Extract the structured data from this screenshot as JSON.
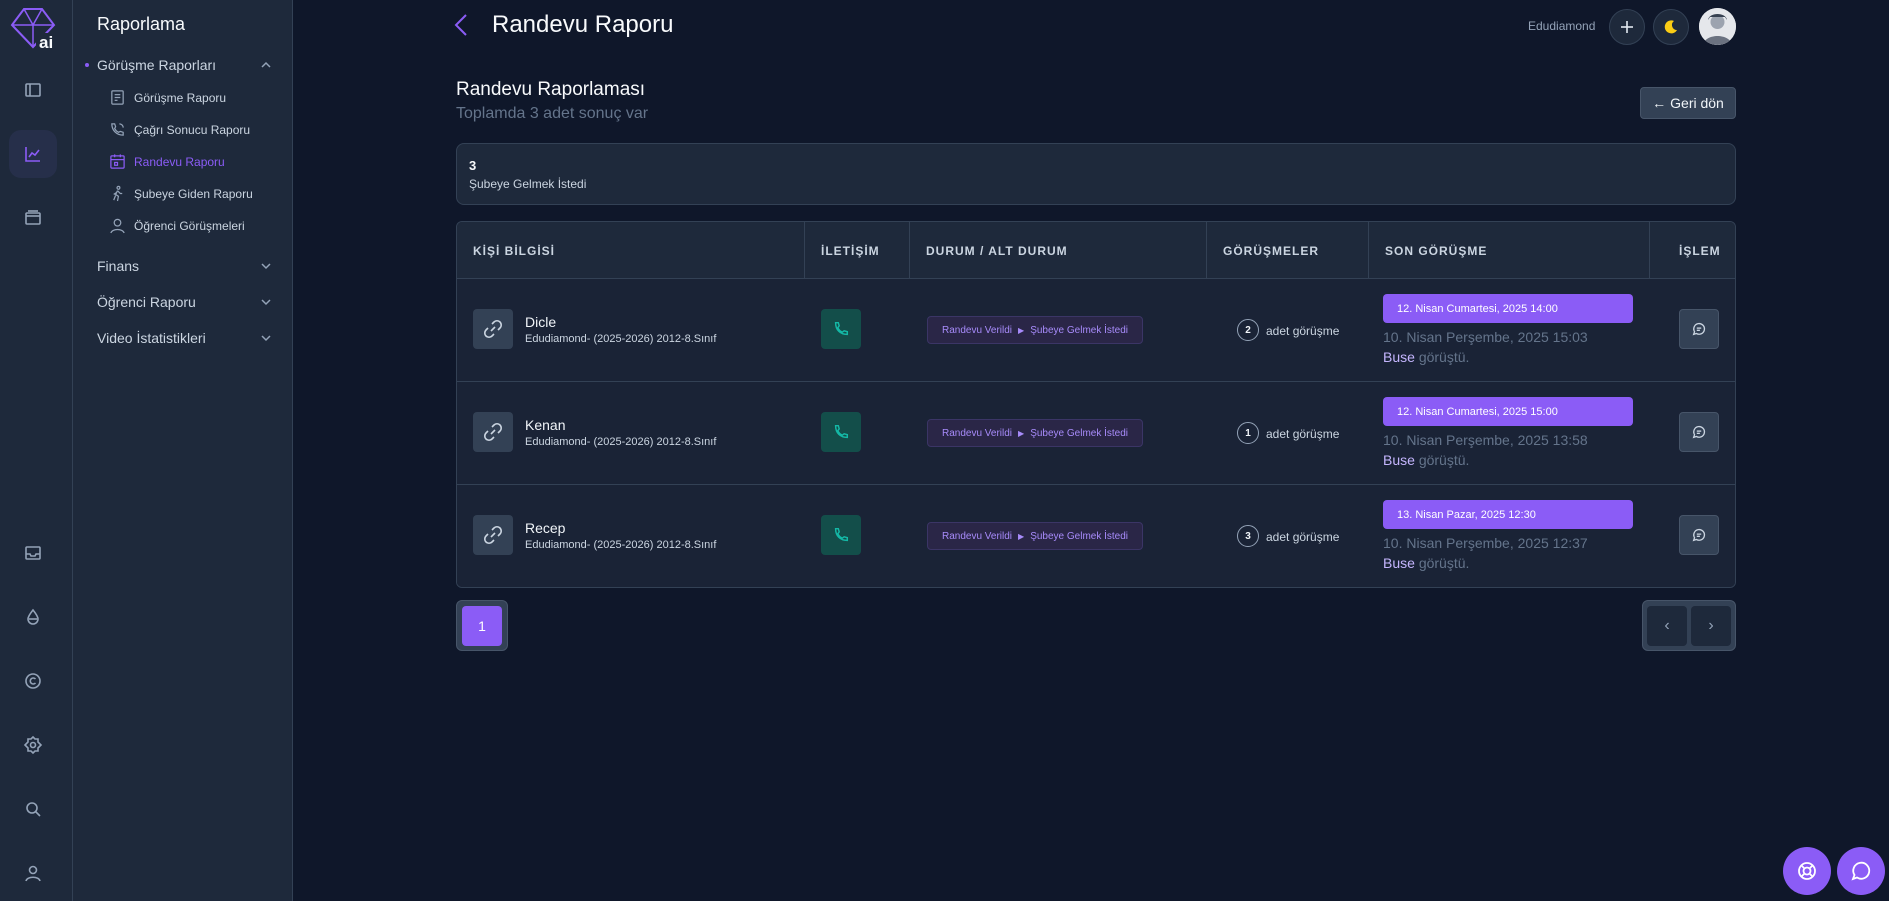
{
  "menu": {
    "title": "Raporlama",
    "group_main": "Görüşme Raporları",
    "items": [
      {
        "label": "Görüşme Raporu",
        "icon": "document-icon"
      },
      {
        "label": "Çağrı Sonucu Raporu",
        "icon": "phone-call-icon"
      },
      {
        "label": "Randevu Raporu",
        "icon": "calendar-icon"
      },
      {
        "label": "Şubeye Giden Raporu",
        "icon": "walking-icon"
      },
      {
        "label": "Öğrenci Görüşmeleri",
        "icon": "user-icon"
      }
    ],
    "groups": [
      "Finans",
      "Öğrenci Raporu",
      "Video İstatistikleri"
    ]
  },
  "header": {
    "title": "Randevu Raporu",
    "user": "Edudiamond"
  },
  "section": {
    "title": "Randevu Raporlaması",
    "subtitle": "Toplamda 3 adet sonuç var",
    "back_label": "Geri dön"
  },
  "stat": {
    "value": "3",
    "label": "Şubeye Gelmek İstedi"
  },
  "table": {
    "columns": [
      "KİŞİ BİLGİSİ",
      "İLETİŞİM",
      "DURUM / ALT DURUM",
      "GÖRÜŞMELER",
      "SON GÖRÜŞME",
      "İŞLEM"
    ],
    "count_suffix": "adet görüşme",
    "rows": [
      {
        "name": "Dicle",
        "desc": "Edudiamond- (2025-2026) 2012-8.Sınıf",
        "status": "Randevu Verildi",
        "substatus": "Şubeye Gelmek İstedi",
        "count": "2",
        "next": "12. Nisan Cumartesi, 2025 14:00",
        "last": "10. Nisan Perşembe, 2025 15:03",
        "who": "Buse",
        "who_suffix": "görüştü."
      },
      {
        "name": "Kenan",
        "desc": "Edudiamond- (2025-2026) 2012-8.Sınıf",
        "status": "Randevu Verildi",
        "substatus": "Şubeye Gelmek İstedi",
        "count": "1",
        "next": "12. Nisan Cumartesi, 2025 15:00",
        "last": "10. Nisan Perşembe, 2025 13:58",
        "who": "Buse",
        "who_suffix": "görüştü."
      },
      {
        "name": "Recep",
        "desc": "Edudiamond- (2025-2026) 2012-8.Sınıf",
        "status": "Randevu Verildi",
        "substatus": "Şubeye Gelmek İstedi",
        "count": "3",
        "next": "13. Nisan Pazar, 2025 12:30",
        "last": "10. Nisan Perşembe, 2025 12:37",
        "who": "Buse",
        "who_suffix": "görüştü."
      }
    ]
  },
  "pagination": {
    "current": "1",
    "prev": "‹",
    "next": "›"
  },
  "colors": {
    "accent": "#8b5cf6",
    "background": "#0f172a",
    "panel": "#1e293b",
    "teal": "#14b8a6"
  }
}
